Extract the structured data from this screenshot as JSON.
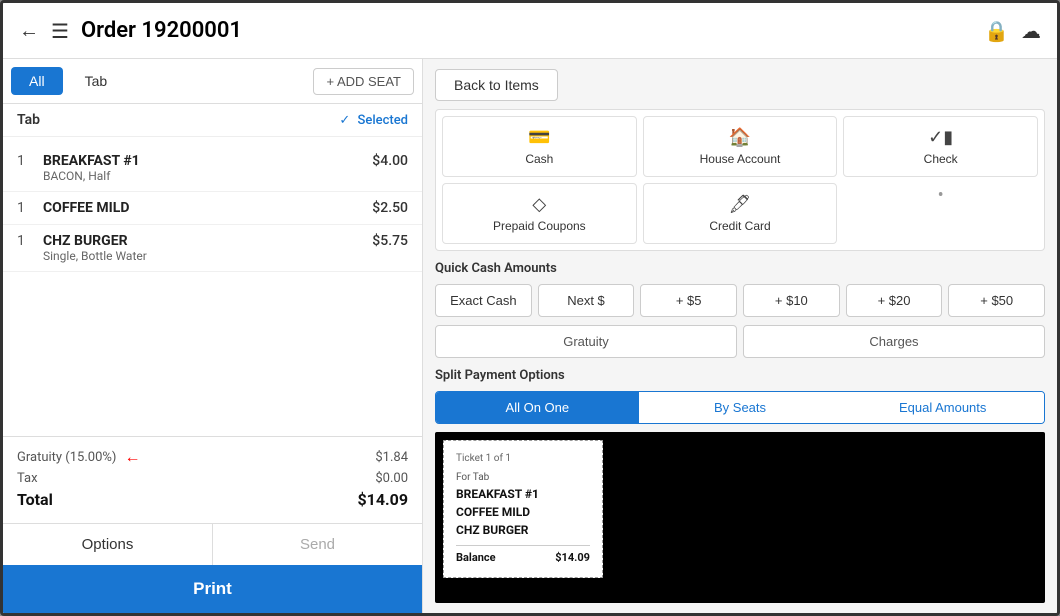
{
  "header": {
    "title": "Order 19200001",
    "back_label": "←",
    "menu_icon": "≡",
    "lock_icon": "🔒",
    "cloud_icon": "☁"
  },
  "left": {
    "tabs": {
      "all_label": "All",
      "tab_label": "Tab",
      "add_seat_label": "+ ADD SEAT"
    },
    "tab_row": {
      "label": "Tab",
      "selected_label": "Selected"
    },
    "items": [
      {
        "qty": "1",
        "name": "BREAKFAST #1",
        "mod": "BACON, Half",
        "price": "$4.00"
      },
      {
        "qty": "1",
        "name": "COFFEE MILD",
        "mod": "",
        "price": "$2.50"
      },
      {
        "qty": "1",
        "name": "CHZ BURGER",
        "mod": "Single, Bottle Water",
        "price": "$5.75"
      }
    ],
    "totals": {
      "gratuity_label": "Gratuity (15.00%)",
      "gratuity_value": "$1.84",
      "tax_label": "Tax",
      "tax_value": "$0.00",
      "total_label": "Total",
      "total_value": "$14.09"
    },
    "buttons": {
      "options_label": "Options",
      "send_label": "Send",
      "print_label": "Print"
    }
  },
  "right": {
    "back_btn_label": "Back to Items",
    "payment_methods": [
      {
        "icon": "💵",
        "label": "Cash"
      },
      {
        "icon": "🏠",
        "label": "House Account"
      },
      {
        "icon": "✅",
        "label": "Check"
      },
      {
        "icon": "◇",
        "label": "Prepaid Coupons"
      },
      {
        "icon": "💳",
        "label": "Credit Card"
      }
    ],
    "quick_cash_label": "Quick Cash Amounts",
    "quick_cash_buttons": [
      "Exact Cash",
      "Next $",
      "+ $5",
      "+ $10",
      "+ $20",
      "+ $50"
    ],
    "gratuity_charges": [
      "Gratuity",
      "Charges"
    ],
    "split_label": "Split Payment Options",
    "split_tabs": [
      {
        "label": "All On One",
        "active": true
      },
      {
        "label": "By Seats",
        "active": false
      },
      {
        "label": "Equal Amounts",
        "active": false
      }
    ],
    "ticket": {
      "header": "Ticket 1 of 1",
      "for_label": "For Tab",
      "items": [
        "BREAKFAST #1",
        "COFFEE MILD",
        "CHZ BURGER"
      ],
      "balance_label": "Balance",
      "balance_value": "$14.09"
    }
  }
}
